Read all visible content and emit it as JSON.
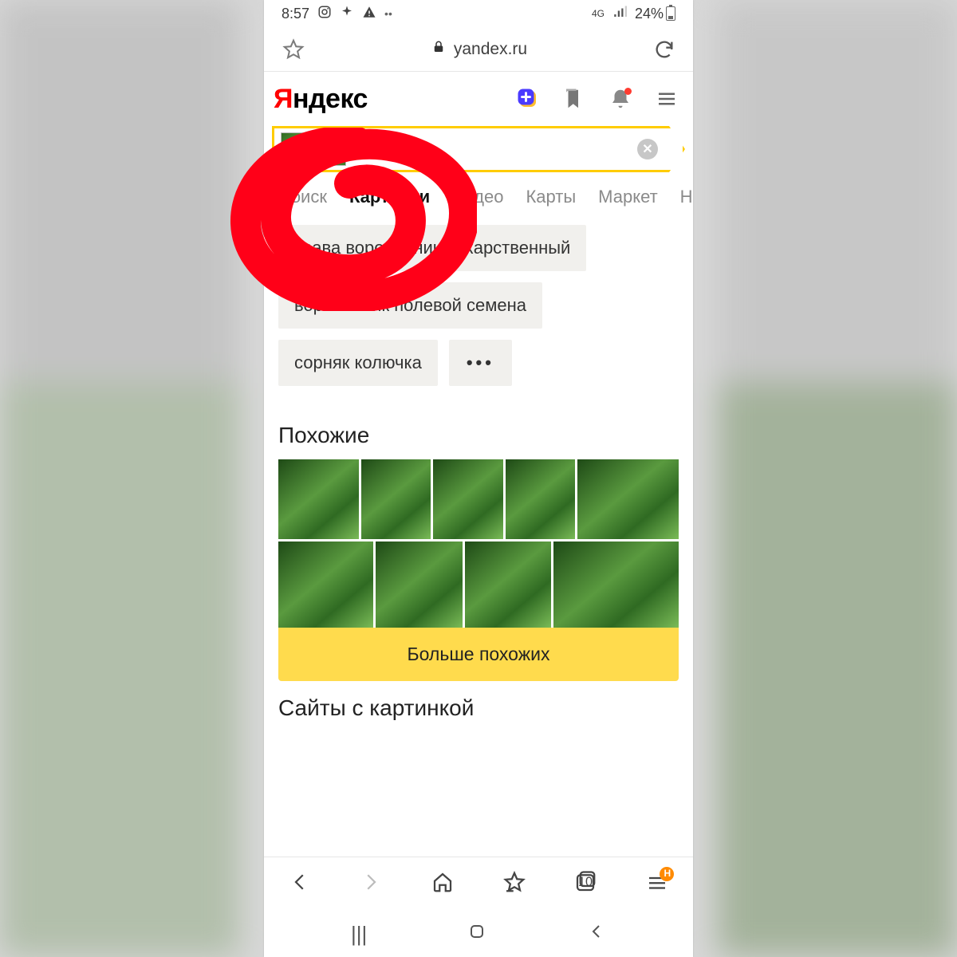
{
  "status": {
    "time": "8:57",
    "network_label": "4G",
    "battery_pct": "24%"
  },
  "browser": {
    "url_host": "yandex.ru"
  },
  "yandex": {
    "logo_prefix": "Я",
    "logo_rest": "ндекс"
  },
  "tabs": {
    "items": [
      {
        "label": "Поиск",
        "active": false
      },
      {
        "label": "Картинки",
        "active": true
      },
      {
        "label": "Видео",
        "active": false
      },
      {
        "label": "Карты",
        "active": false
      },
      {
        "label": "Маркет",
        "active": false
      },
      {
        "label": "Новости",
        "active": false
      }
    ]
  },
  "suggestions": {
    "items": [
      "трава воробейник лекарственный",
      "воробейник полевой семена",
      "сорняк колючка"
    ],
    "more_label": "•••"
  },
  "sections": {
    "similar_heading": "Похожие",
    "more_similar_btn": "Больше похожих",
    "sites_heading": "Сайты с картинкой"
  },
  "bottom_nav": {
    "tab_count": "10",
    "badge_letter": "Н"
  }
}
